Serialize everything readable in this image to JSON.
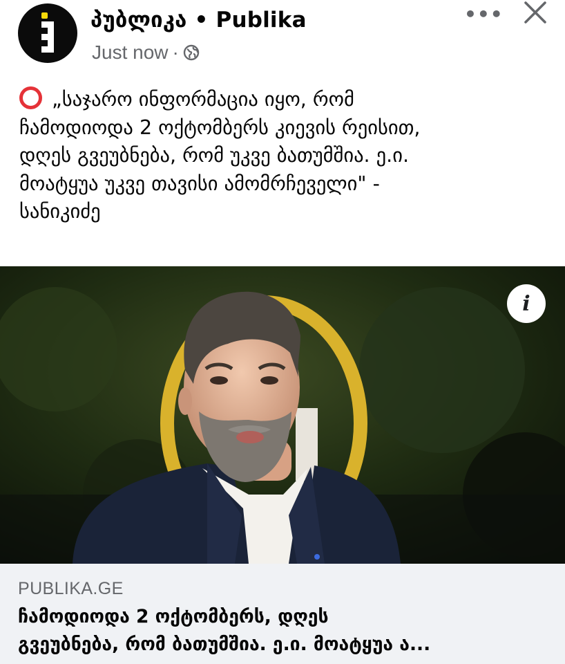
{
  "header": {
    "page_name": "პუბლიკა • Publika",
    "timestamp": "Just now",
    "separator": "·",
    "audience_icon": "globe-icon",
    "more_icon": "more-options-icon",
    "more_label": "•••",
    "close_icon": "close-icon"
  },
  "post": {
    "emoji": "red-circle-icon",
    "lines": [
      "„საჯარო ინფორმაცია იყო, რომ",
      "ჩამოდიოდა 2 ოქტომბერს კიევის რეისით,",
      "დღეს გვეუბნება, რომ უკვე ბათუმშია. ე.ი.",
      "მოატყუა უკვე თავისი ამომრჩეველი\" -",
      "სანიკიძე"
    ]
  },
  "image": {
    "alt_icon": "info-icon",
    "info_label": "i"
  },
  "link_preview": {
    "domain": "PUBLIKA.GE",
    "title_lines": [
      "ჩამოდიოდა 2 ოქტომბერს, დღეს",
      "გვეუბნება, რომ ბათუმშია. ე.ი. მოატყუა ა..."
    ]
  },
  "colors": {
    "accent_red": "#e53238",
    "logo_yellow": "#f5d90a",
    "meta_gray": "#65676b",
    "card_bg": "#f0f2f5"
  }
}
